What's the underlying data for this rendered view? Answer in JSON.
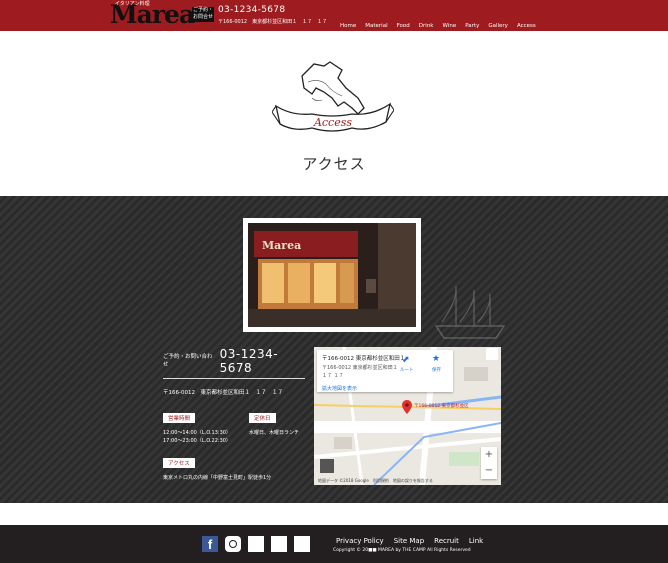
{
  "header": {
    "logo": "Marea",
    "logo_tag": "イタリアン料理",
    "ribbon": "ご予約・お問合せ",
    "phone": "03-1234-5678",
    "address": "〒166-0012　東京都杉並区和田１　１７　１７",
    "nav": [
      "Home",
      "Material",
      "Food",
      "Drink",
      "Wine",
      "Party",
      "Gallery",
      "Access"
    ]
  },
  "hero": {
    "script_label": "Access",
    "title": "アクセス"
  },
  "info": {
    "phone_label": "ご予約・お問い合わせ",
    "phone": "03-1234-5678",
    "address": "〒166-0012　東京都杉並区和田１　１７　１７",
    "hours_label": "営業時間",
    "hours": [
      "12:00〜14:00（L.O.13:30）",
      "17:00〜23:00（L.O.22:30）"
    ],
    "holiday_label": "定休日",
    "holiday": "水曜日、木曜日ランチ",
    "access_label": "アクセス",
    "access": "東京メトロ丸の内線「中野富士見町」駅徒歩1分"
  },
  "map": {
    "card_title": "〒166-0012 東京都杉並区和田１",
    "card_sub": "〒166-0012 東京都杉並区和田１",
    "card_sub2": "１７ １７",
    "directions": "ルート",
    "save": "保存",
    "larger_map": "拡大地図を表示",
    "pin_label": "〒166-0012 東京都杉並区",
    "footer": "地図データ ©2018 Google　利用規約　地図の誤りを報告する"
  },
  "footer": {
    "links": [
      "Privacy Policy",
      "Site Map",
      "Recruit",
      "Link"
    ],
    "copyright": "Copyright © 20■■ MAREA  by THE CAMP  All Rights Reserved"
  },
  "colors": {
    "brand_red": "#9e1b1f",
    "dark_bg": "#2a2a2a",
    "footer_bg": "#231f20"
  }
}
